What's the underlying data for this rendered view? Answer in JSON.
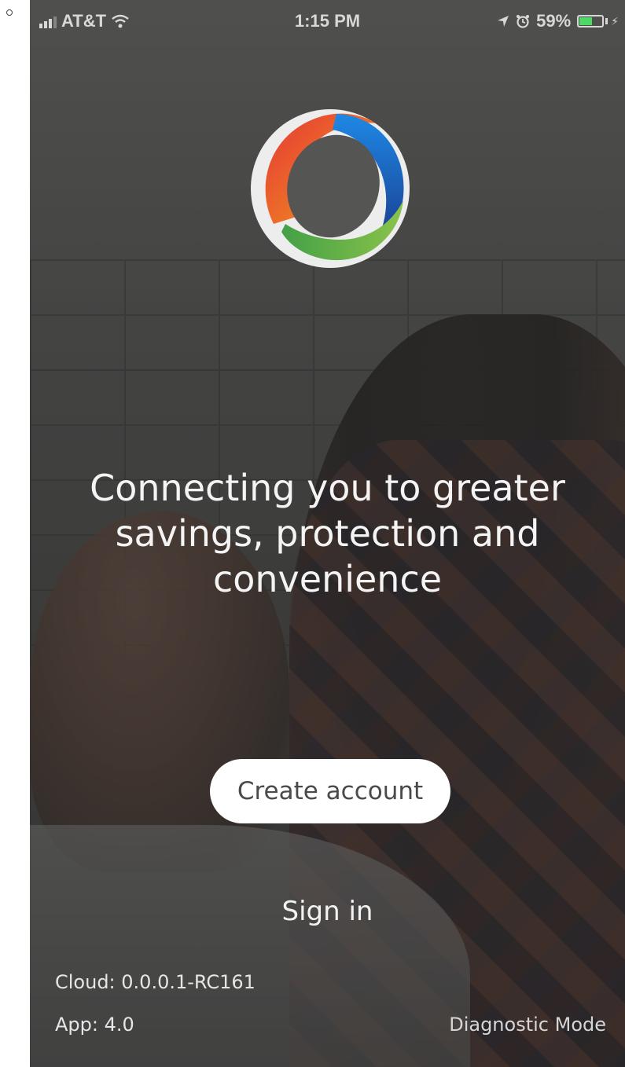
{
  "status_bar": {
    "carrier": "AT&T",
    "time": "1:15 PM",
    "battery_percent": "59%",
    "battery_level": 0.59,
    "icons": [
      "signal-icon",
      "wifi-icon",
      "location-icon",
      "alarm-icon",
      "battery-icon",
      "charging-icon"
    ]
  },
  "logo": {
    "icon": "ring-logo-icon",
    "colors": [
      "#e53935",
      "#f39a1e",
      "#1e88e5",
      "#1a3d8f",
      "#43a047",
      "#8bc34a"
    ]
  },
  "hero": {
    "tagline_lines": [
      "Connecting you to greater",
      "savings, protection and",
      "convenience"
    ]
  },
  "actions": {
    "create_account_label": "Create account",
    "sign_in_label": "Sign in"
  },
  "footer": {
    "cloud_version": "Cloud: 0.0.0.1-RC161",
    "app_version": "App: 4.0",
    "diagnostic_mode_label": "Diagnostic Mode"
  },
  "colors": {
    "button_bg": "#ffffff",
    "button_text": "#4a4a4a",
    "text_light": "#f4f4f4"
  }
}
